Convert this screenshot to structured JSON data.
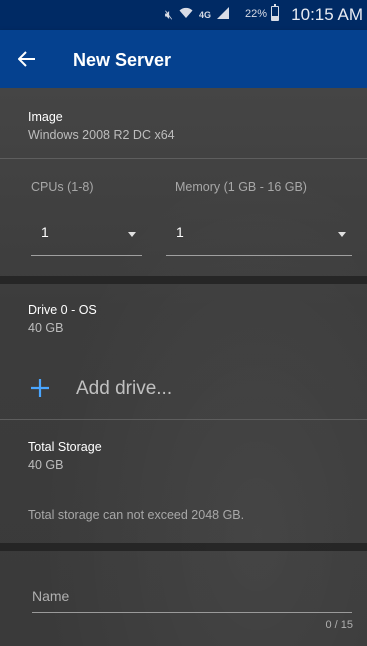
{
  "status_bar": {
    "icons": [
      "mute-icon",
      "wifi-icon",
      "lte-icon",
      "signal-icon",
      "battery-icon"
    ],
    "lte_label": "4G",
    "battery": "22%",
    "time": "10:15 AM"
  },
  "app_bar": {
    "title": "New Server",
    "back_icon": "arrow-left-icon"
  },
  "image": {
    "label": "Image",
    "value": "Windows 2008 R2 DC x64"
  },
  "cpus": {
    "label": "CPUs (1-8)",
    "selected": "1"
  },
  "memory": {
    "label": "Memory (1 GB - 16 GB)",
    "selected": "1"
  },
  "drive": {
    "label": "Drive 0 - OS",
    "size": "40 GB"
  },
  "add_drive": {
    "label": "Add drive...",
    "icon": "plus-icon"
  },
  "total_storage": {
    "label": "Total Storage",
    "value": "40 GB",
    "note": "Total storage can not exceed 2048 GB."
  },
  "name_field": {
    "placeholder": "Name",
    "value": "",
    "counter": "0 / 15"
  },
  "colors": {
    "status_bar": "#002a64",
    "app_bar": "#05418f",
    "accent_plus": "#4aa6ff",
    "background": "#3a3a3a"
  }
}
